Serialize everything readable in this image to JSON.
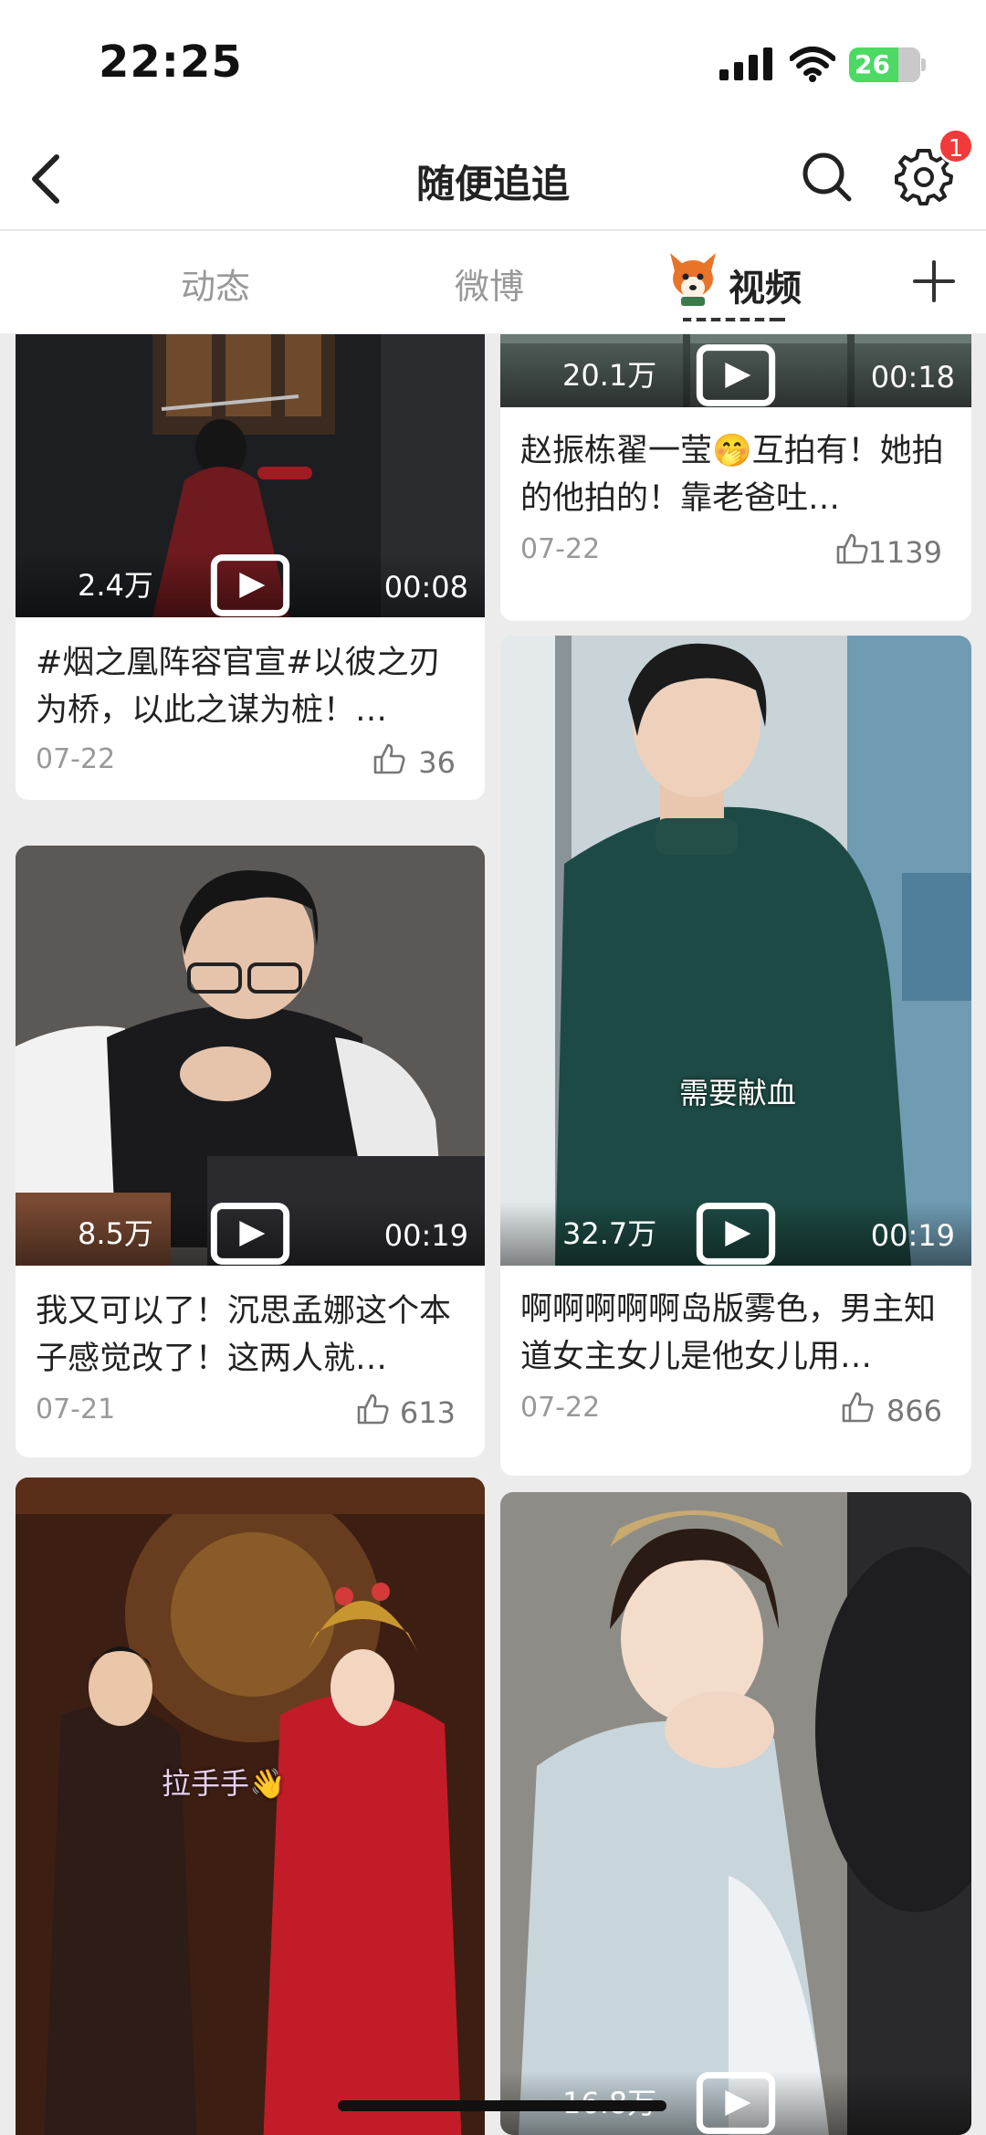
{
  "status_bar": {
    "time": "22:25",
    "battery": "26"
  },
  "navbar": {
    "title": "随便追追",
    "notification_count": "1"
  },
  "tabs": [
    {
      "label": "动态",
      "active": false
    },
    {
      "label": "微博",
      "active": false
    },
    {
      "label": "视频",
      "active": true
    }
  ],
  "colors": {
    "badge": "#f23a3a",
    "battery": "#4cd964",
    "active_tab": "#222222",
    "inactive_tab": "#999999"
  },
  "feed": {
    "left": [
      {
        "views": "2.4万",
        "duration": "00:08",
        "caption": "#烟之凰阵容官宣#以彼之刃为桥，以此之谋为桩！…",
        "date": "07-22",
        "likes": "36"
      },
      {
        "views": "8.5万",
        "duration": "00:19",
        "caption": "我又可以了！沉思孟娜这个本子感觉改了！这两人就…",
        "date": "07-21",
        "likes": "613"
      },
      {
        "overlay": "拉手手👋"
      }
    ],
    "right": [
      {
        "views": "20.1万",
        "duration": "00:18",
        "caption": "赵振栋翟一莹🤭互拍有！她拍的他拍的！靠老爸吐…",
        "date": "07-22",
        "likes": "1139"
      },
      {
        "views": "32.7万",
        "duration": "00:19",
        "overlay": "需要献血",
        "caption": "啊啊啊啊啊岛版雾色，男主知道女主女儿是他女儿用…",
        "date": "07-22",
        "likes": "866"
      },
      {
        "views": "16.8万"
      }
    ]
  }
}
